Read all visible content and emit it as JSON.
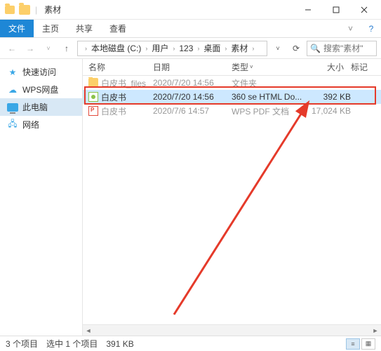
{
  "title": "素材",
  "menu": {
    "file": "文件",
    "home": "主页",
    "share": "共享",
    "view": "查看"
  },
  "breadcrumb": [
    "本地磁盘 (C:)",
    "用户",
    "123",
    "桌面",
    "素材"
  ],
  "search": {
    "placeholder": "搜索\"素材\""
  },
  "sidebar": {
    "quick": "快速访问",
    "wps": "WPS网盘",
    "pc": "此电脑",
    "network": "网络"
  },
  "columns": {
    "name": "名称",
    "date": "日期",
    "type": "类型",
    "size": "大小",
    "mark": "标记"
  },
  "rows": [
    {
      "name": "白皮书_files",
      "date": "2020/7/20 14:56",
      "type": "文件夹",
      "size": ""
    },
    {
      "name": "白皮书",
      "date": "2020/7/20 14:56",
      "type": "360 se HTML Do...",
      "size": "392 KB"
    },
    {
      "name": "白皮书",
      "date": "2020/7/6 14:57",
      "type": "WPS PDF 文档",
      "size": "17,024 KB"
    }
  ],
  "status": {
    "count": "3 个项目",
    "selected": "选中 1 个项目",
    "size": "391 KB"
  },
  "help_char": "?"
}
